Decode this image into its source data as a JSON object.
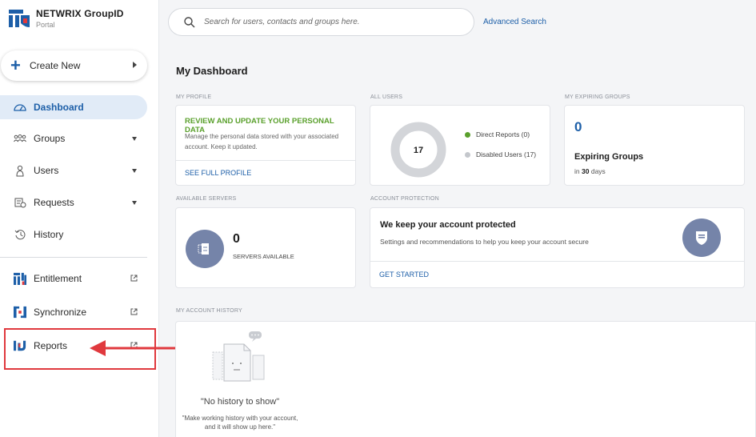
{
  "brand": {
    "title": "NETWRIX GroupID",
    "subtitle": "Portal"
  },
  "create_new": {
    "label": "Create New"
  },
  "nav": {
    "dashboard": "Dashboard",
    "groups": "Groups",
    "users": "Users",
    "requests": "Requests",
    "history": "History",
    "entitlement": "Entitlement",
    "synchronize": "Synchronize",
    "reports": "Reports"
  },
  "search": {
    "placeholder": "Search for users, contacts and groups here.",
    "advanced_label": "Advanced Search"
  },
  "dashboard": {
    "title": "My Dashboard",
    "my_profile": {
      "section": "MY PROFILE",
      "heading": "REVIEW AND UPDATE YOUR PERSONAL DATA",
      "description": "Manage the personal data stored with your associated account. Keep it updated.",
      "link": "SEE FULL PROFILE"
    },
    "all_users": {
      "section": "ALL USERS",
      "total": "17",
      "direct_reports": "Direct Reports (0)",
      "disabled_users": "Disabled Users (17)",
      "direct_reports_value": 0,
      "disabled_users_value": 17
    },
    "expiring_groups": {
      "section": "MY EXPIRING GROUPS",
      "count": "0",
      "title": "Expiring Groups",
      "sub_prefix": "in",
      "days": "30",
      "sub_suffix": "days"
    },
    "servers": {
      "section": "AVAILABLE SERVERS",
      "count": "0",
      "label": "SERVERS AVAILABLE"
    },
    "protection": {
      "section": "ACCOUNT PROTECTION",
      "title": "We keep your account protected",
      "description": "Settings and recommendations to help you keep your account secure",
      "link": "GET STARTED"
    },
    "history": {
      "section": "MY ACCOUNT HISTORY",
      "title": "\"No history to show\"",
      "description": "\"Make working history with your account, and it will show up here.\""
    }
  },
  "colors": {
    "accent": "#1d5fa8",
    "active_bg": "#e1ebf7",
    "green": "#5aa02c",
    "donut_gray": "#d3d5d9",
    "icon_circle": "#7584a9",
    "annotation_red": "#e0393e"
  },
  "icons": {
    "logo": "netwrix-logo",
    "create": "plus-icon",
    "dashboard": "speedometer-icon",
    "groups": "group-icon",
    "users": "user-icon",
    "requests": "requests-icon",
    "history": "history-icon",
    "entitlement": "entitlement-icon",
    "synchronize": "synchronize-icon",
    "reports": "reports-icon",
    "external": "external-link-icon",
    "search": "search-icon",
    "servers": "server-icon",
    "shield": "shield-icon"
  }
}
